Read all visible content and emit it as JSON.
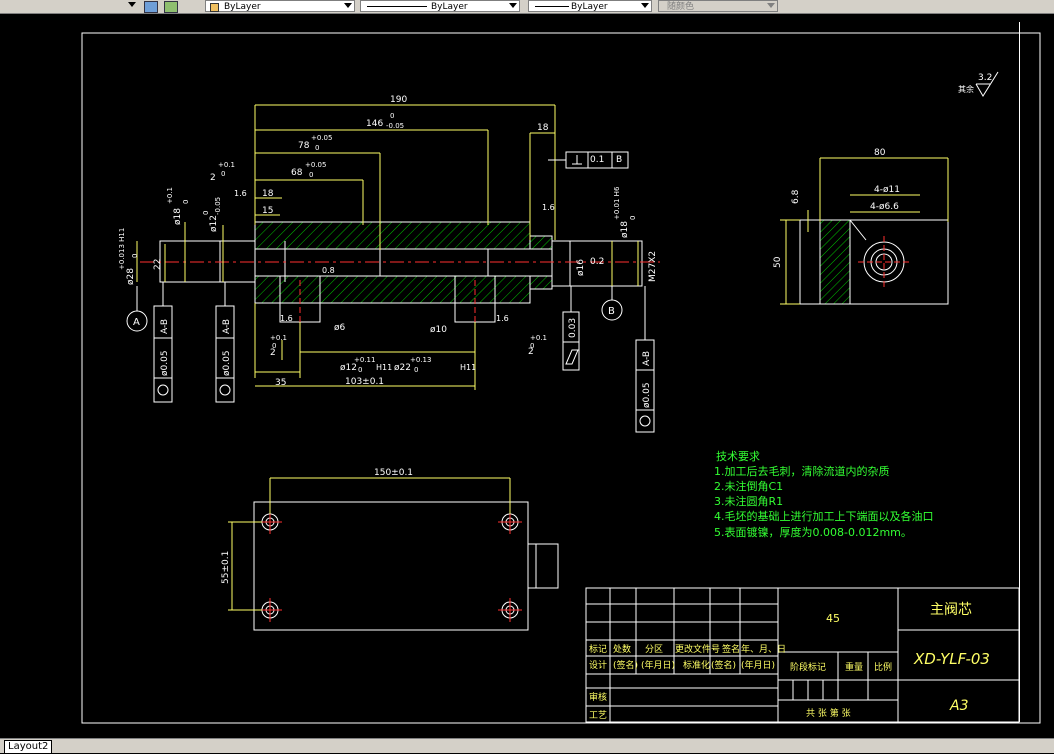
{
  "toolbar": {
    "layer_label": "ByLayer",
    "linetype_label": "ByLayer",
    "lineweight_label": "ByLayer",
    "plotstyle_label": "随颜色"
  },
  "tabs": {
    "active": "Layout2"
  },
  "drawing": {
    "roughness_note": "其余",
    "roughness_value": "3.2",
    "dims_main": {
      "d190": "190",
      "d146": "146",
      "d146_tol_up": "0",
      "d146_tol_dn": "-0.05",
      "d78": "78",
      "d78_tol_up": "+0.05",
      "d78_tol_dn": "0",
      "d68": "68",
      "d68_tol_up": "+0.05",
      "d68_tol_dn": "0",
      "d18_top": "18",
      "d2": "2",
      "d2_tol_up": "+0.1",
      "d2_tol_dn": "0",
      "d18_left": "18",
      "d15": "15",
      "phi18": "ø18",
      "phi18_tol_up": "+0.1",
      "phi18_tol_dn": "0",
      "phi12": "ø12",
      "phi12_tol_up": "0",
      "phi12_tol_dn": "-0.05",
      "phi28": "ø28",
      "phi28_tol": "+0.013 H11",
      "phi28_tol_dn": "0",
      "d22": "22",
      "phi18_right": "ø18",
      "phi18_right_tol": "+0.01 H6",
      "phi18_right_tol_dn": "0",
      "phi16": "ø16",
      "m27": "M27X2",
      "flat_box": "0.1",
      "flat_datum": "B",
      "d0_2": "0.2",
      "d0_8": "0.8",
      "r16_a": "1.6",
      "r16_b": "1.6",
      "r16_c": "1.6",
      "r16_d": "1.6",
      "phi6": "ø6",
      "phi10": "ø10",
      "d2_lower_left": "2",
      "d2_lower_left_tol": "+0.1",
      "d2_lower_left_tol_dn": "0",
      "d2_lower_right": "2",
      "d2_lower_right_tol": "+0.1",
      "d2_lower_right_tol_dn": "0",
      "phi12_bot": "ø12",
      "phi12_bot_tol": "+0.11",
      "phi12_bot_tol_dn": "0",
      "h11_a": "H11",
      "phi22_bot": "ø22",
      "phi22_bot_tol": "+0.13",
      "phi22_bot_tol_dn": "0",
      "h11_b": "H11",
      "d35": "35",
      "d103": "103±0.1",
      "datum_a": "A",
      "datum_b": "B",
      "gdt_left1_tol": "ø0.05",
      "gdt_left1_ref": "A-B",
      "gdt_left2_tol": "ø0.05",
      "gdt_left2_ref": "A-B",
      "gdt_right_tol": "ø0.05",
      "gdt_right_ref": "A-B",
      "gdt_cyl_tol": "0.03"
    },
    "dims_side": {
      "d80": "80",
      "d6_8": "6.8",
      "d50": "50",
      "holes11": "4-ø11",
      "holes6_6": "4-ø6.6"
    },
    "dims_bottom": {
      "d150": "150±0.1",
      "d55": "55±0.1"
    },
    "tech_notes": {
      "title": "技术要求",
      "lines": [
        "1.加工后去毛刺，清除流道内的杂质",
        "2.未注倒角C1",
        "3.未注圆角R1",
        "4.毛坯的基础上进行加工上下端面以及各油口",
        "5.表面镀镍，厚度为0.008-0.012mm。"
      ]
    },
    "title_block": {
      "material": "45",
      "part_name": "主阀芯",
      "drawing_no": "XD-YLF-03",
      "size": "A3",
      "row_labels": [
        "标记",
        "处数",
        "分区",
        "更改文件号",
        "签名",
        "年、月、日"
      ],
      "design_row": [
        "设计",
        "(签名)",
        "(年月日)",
        "标准化",
        "(签名)",
        "(年月日)"
      ],
      "stage_labels": [
        "阶段标记",
        "重量",
        "比例"
      ],
      "review": "审核",
      "process": "工艺",
      "sheets": "共  张  第  张"
    }
  },
  "colors": {
    "outline": "#ffffff",
    "dimension": "#ffff66",
    "center": "#ff3030",
    "hatch": "#00c000",
    "text_green": "#33ff33",
    "gdt": "#ffffff"
  }
}
